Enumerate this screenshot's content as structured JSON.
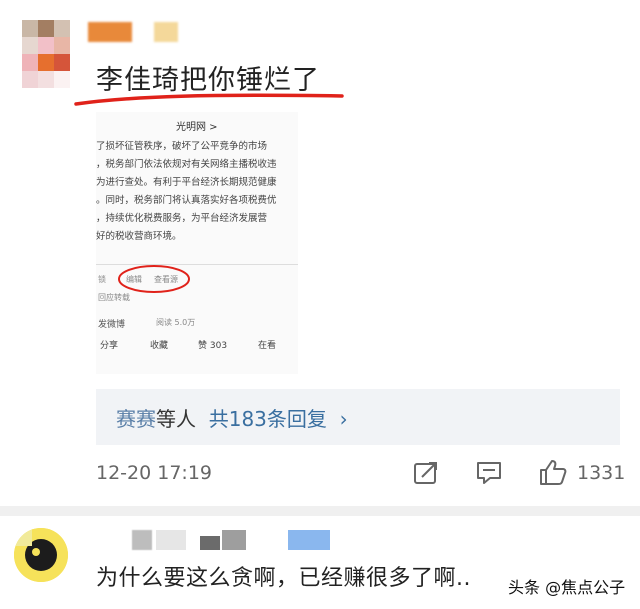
{
  "comment1": {
    "text": "李佳琦把你锤烂了",
    "embed": {
      "source": "光明网 >",
      "lines": [
        "了损坏征管秩序，破坏了公平竞争的市场",
        "，税务部门依法依规对有关网络主播税收违",
        "为进行查处。有利于平台经济长期规范健康",
        "。同时，税务部门将认真落实好各项税费优",
        "，持续优化税费服务，为平台经济发展营",
        "好的税收营商环境。"
      ],
      "meta_row1": [
        "锁",
        "编辑",
        "查看源"
      ],
      "meta_row2": "回应转载",
      "viewer": "发微博",
      "views": "阅读 5.0万",
      "actions": {
        "share": "分享",
        "favorite": "收藏",
        "like": "赞 303",
        "watch": "在看"
      }
    },
    "reply": {
      "users": "赛赛",
      "etc": "等人",
      "count": "共183条回复",
      "chevron": "›"
    },
    "timestamp": "12-20 17:19",
    "likes": "1331",
    "icons": [
      "share-icon",
      "comment-icon",
      "like-icon"
    ]
  },
  "comment2": {
    "text": "为什么要这么贪啊，已经赚很多了啊.."
  },
  "watermark": "头条 @焦点公子",
  "colors": {
    "accent_red": "#e0221a",
    "reply_blue": "#3a6fa0",
    "reply_bg": "#f1f3f6"
  }
}
